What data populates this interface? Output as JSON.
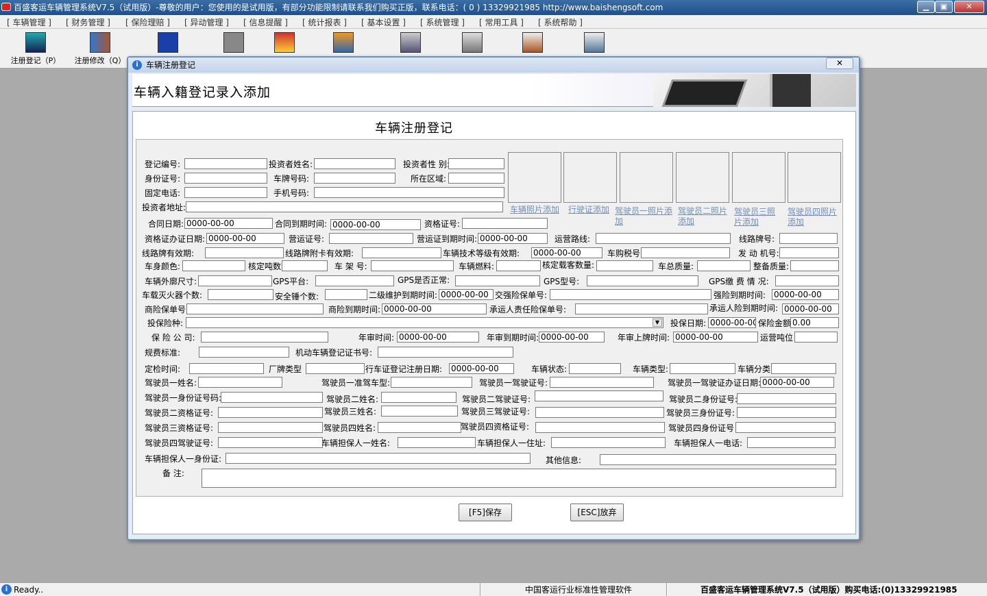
{
  "window": {
    "title": "百盛客运车辆管理系统V7.5（试用版）-尊敬的用户：您使用的是试用版，有部分功能限制请联系我们购买正版，联系电话：( 0 ) 13329921985  http://www.baishengsoft.com",
    "min": "▁",
    "max": "▣",
    "close": "✕"
  },
  "menu": [
    "[ 车辆管理 ]",
    "[ 财务管理 ]",
    "[ 保险理赔 ]",
    "[ 异动管理 ]",
    "[ 信息提醒 ]",
    "[ 统计报表 ]",
    "[ 基本设置 ]",
    "[ 系统管理 ]",
    "[ 常用工具 ]",
    "[ 系统帮助 ]"
  ],
  "toolbar": {
    "register": "注册登记（P）",
    "modify": "注册修改（Q）"
  },
  "dialog": {
    "title": "车辆注册登记",
    "close": "✕",
    "banner": "车辆入籍登记录入添加",
    "form_title": "车辆注册登记",
    "info": "i"
  },
  "labels": {
    "a1": "登记编号:",
    "a2": "投资者姓名:",
    "a3": "投资者性 别:",
    "b1": "身份证号:",
    "b2": "车牌号码:",
    "b3": "所在区域:",
    "c1": "固定电话:",
    "c2": "手机号码:",
    "d1": "投资者地址:",
    "e1": "合同日期:",
    "e2": "合同到期时间:",
    "e3": "资格证号:",
    "f1": "资格证办证日期:",
    "f2": "营运证号:",
    "f3": "营运证到期时间:",
    "f4": "运营路线:",
    "f5": "线路牌号:",
    "g1": "线路牌有效期:",
    "g2": "线路牌附卡有效期:",
    "g3": "车辆技术等级有效期:",
    "g4": "车购税号",
    "g5": "发 动 机号:",
    "h1": "车身颜色:",
    "h2": "核定吨数",
    "h3": "车 架 号:",
    "h4": "车辆燃料:",
    "h5": "核定载客数量:",
    "h6": "车总质量:",
    "h7": "整备质量:",
    "i1": "车辆外廓尺寸:",
    "i2": "GPS平台:",
    "i3": "GPS是否正常:",
    "i4": "GPS型号:",
    "i5": "GPS缴 费 情 况:",
    "j1": "车载灭火器个数:",
    "j2": "安全锤个数:",
    "j3": "二级维护到期时间:",
    "j4": "交强险保单号:",
    "j5": "强险到期时间:",
    "k1": "商险保单号",
    "k2": "商险到期时间:",
    "k3": "承运人责任险保单号:",
    "k4": "承运人险到期时间:",
    "l1": "投保险种:",
    "l2": "投保日期:",
    "l3": "保险金额",
    "m1": "保 险 公 司:",
    "m2": "年审时间:",
    "m3": "年审到期时间:",
    "m4": "年审上牌时间:",
    "m5": "运营吨位",
    "n1": "规费标准:",
    "n2": "机动车辆登记证书号:",
    "o1": "定检时间:",
    "o2": "厂牌类型",
    "o3": "行车证登记注册日期:",
    "o4": "车辆状态:",
    "o5": "车辆类型:",
    "o6": "车辆分类",
    "p1": "驾驶员一姓名:",
    "p2": "驾驶员一准驾车型:",
    "p3": "驾驶员一驾驶证号:",
    "p4": "驾驶员一驾驶证办证日期:",
    "q1": "驾驶员一身份证号码:",
    "q2": "驾驶员二姓名:",
    "q3": "驾驶员二驾驶证号:",
    "q4": "驾驶员二身份证号:",
    "r1": "驾驶员二资格证号:",
    "r2": "驾驶员三姓名:",
    "r3": "驾驶员三驾驶证号:",
    "r4": "驾驶员三身份证号:",
    "s1": "驾驶员三资格证号:",
    "s2": "驾驶员四姓名:",
    "s3": "驾驶员四资格证号:",
    "s4": "驾驶员四身份证号",
    "t1": "驾驶员四驾驶证号:",
    "t2": "车辆担保人一姓名:",
    "t3": "车辆担保人一住址:",
    "t4": "车辆担保人一电话:",
    "u1": "车辆担保人一身份证:",
    "u2": "其他信息:",
    "v1": "备    注:"
  },
  "values": {
    "date": "0000-00-00",
    "amount": "0.00",
    "dd": "▼"
  },
  "photos": [
    "车辆照片添加",
    "行驶证添加",
    "驾驶员一照片添加",
    "驾驶员二照片添加",
    "驾驶员三照片添加",
    "驾驶员四照片添加"
  ],
  "buttons": {
    "save": "[F5]保存",
    "cancel": "[ESC]放弃"
  },
  "status": {
    "ready": "Ready..",
    "middle": "中国客运行业标准性管理软件",
    "right": "百盛客运车辆管理系统V7.5（试用版）购买电话:(0)13329921985",
    "icon": "i"
  }
}
